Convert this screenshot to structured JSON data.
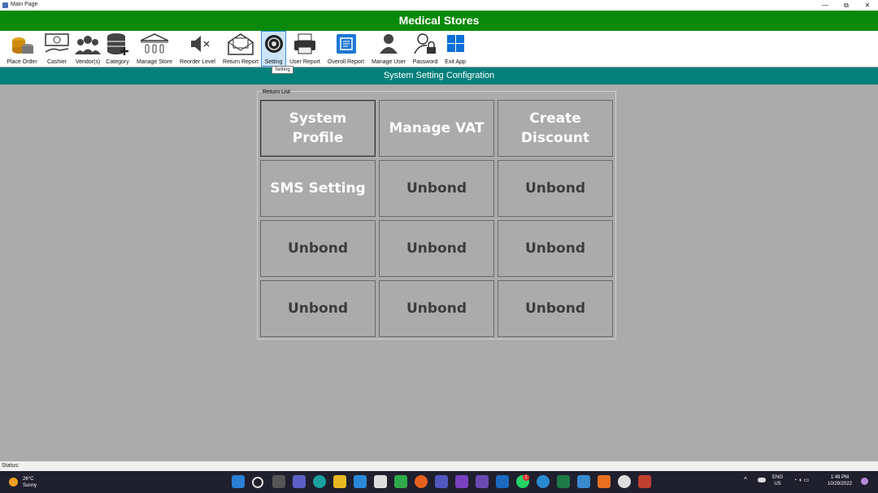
{
  "window": {
    "title": "Main Page",
    "minimize": "—",
    "restore": "⧉",
    "close": "✕"
  },
  "header": {
    "title": "Medical Stores"
  },
  "toolbar": {
    "items": [
      {
        "label": "Place Order",
        "icon": "coins-database-icon"
      },
      {
        "label": "Cashier",
        "icon": "cash-hand-icon"
      },
      {
        "label": "Vendor(s)",
        "icon": "users-group-icon"
      },
      {
        "label": "Category",
        "icon": "database-add-icon"
      },
      {
        "label": "Manage Store",
        "icon": "bank-building-icon"
      },
      {
        "label": "Reorder Level",
        "icon": "speaker-mute-icon"
      },
      {
        "label": "Return Report",
        "icon": "mail-open-icon"
      },
      {
        "label": "Setting",
        "icon": "gear-icon",
        "active": true
      },
      {
        "label": "User Report",
        "icon": "printer-icon"
      },
      {
        "label": "Overoll Report",
        "icon": "report-icon"
      },
      {
        "label": "Manage User",
        "icon": "user-icon"
      },
      {
        "label": "Password",
        "icon": "user-lock-icon"
      },
      {
        "label": "Exit App",
        "icon": "windows-logo-icon"
      }
    ],
    "tooltip": "Setting"
  },
  "section": {
    "title": "System Setting Configration"
  },
  "group": {
    "label": "Return List",
    "buttons": [
      "System Profile",
      "Manage VAT",
      "Create Discount",
      "SMS Setting",
      "Unbond",
      "Unbond",
      "Unbond",
      "Unbond",
      "Unbond",
      "Unbond",
      "Unbond",
      "Unbond"
    ]
  },
  "status": {
    "text": "Status:"
  },
  "taskbar": {
    "weather": {
      "temp": "26°C",
      "condition": "Sunny"
    },
    "language": {
      "lang": "ENG",
      "region": "US"
    },
    "clock": {
      "time": "1:49 PM",
      "date": "10/29/2022"
    },
    "notification_badge": "1"
  },
  "colors": {
    "header_green": "#0a8a0a",
    "section_teal": "#04807a",
    "background": "#ababab"
  }
}
